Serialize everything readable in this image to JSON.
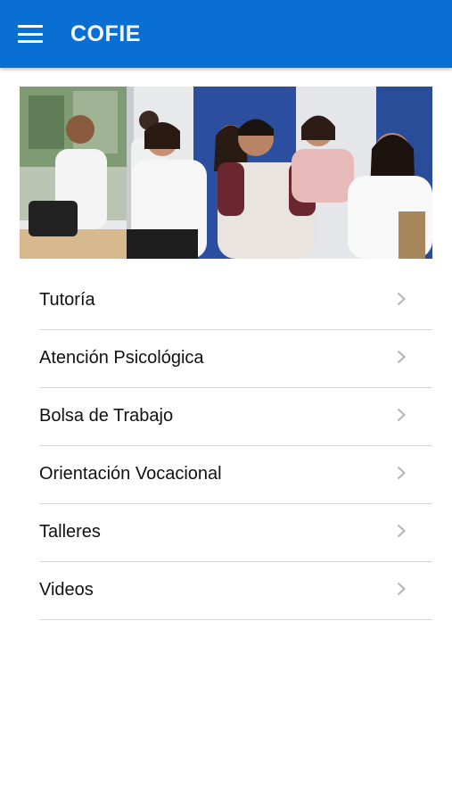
{
  "appbar": {
    "title": "COFIE",
    "menu_icon": "hamburger-menu-icon",
    "color": "#0a6fd2"
  },
  "hero": {
    "image": "photo of smiling students seated in a classroom"
  },
  "menu": {
    "items": [
      {
        "label": "Tutoría",
        "icon": "chevron-right-icon"
      },
      {
        "label": "Atención Psicológica",
        "icon": "chevron-right-icon"
      },
      {
        "label": "Bolsa de Trabajo",
        "icon": "chevron-right-icon"
      },
      {
        "label": "Orientación Vocacional",
        "icon": "chevron-right-icon"
      },
      {
        "label": "Talleres",
        "icon": "chevron-right-icon"
      },
      {
        "label": "Videos",
        "icon": "chevron-right-icon"
      }
    ]
  }
}
